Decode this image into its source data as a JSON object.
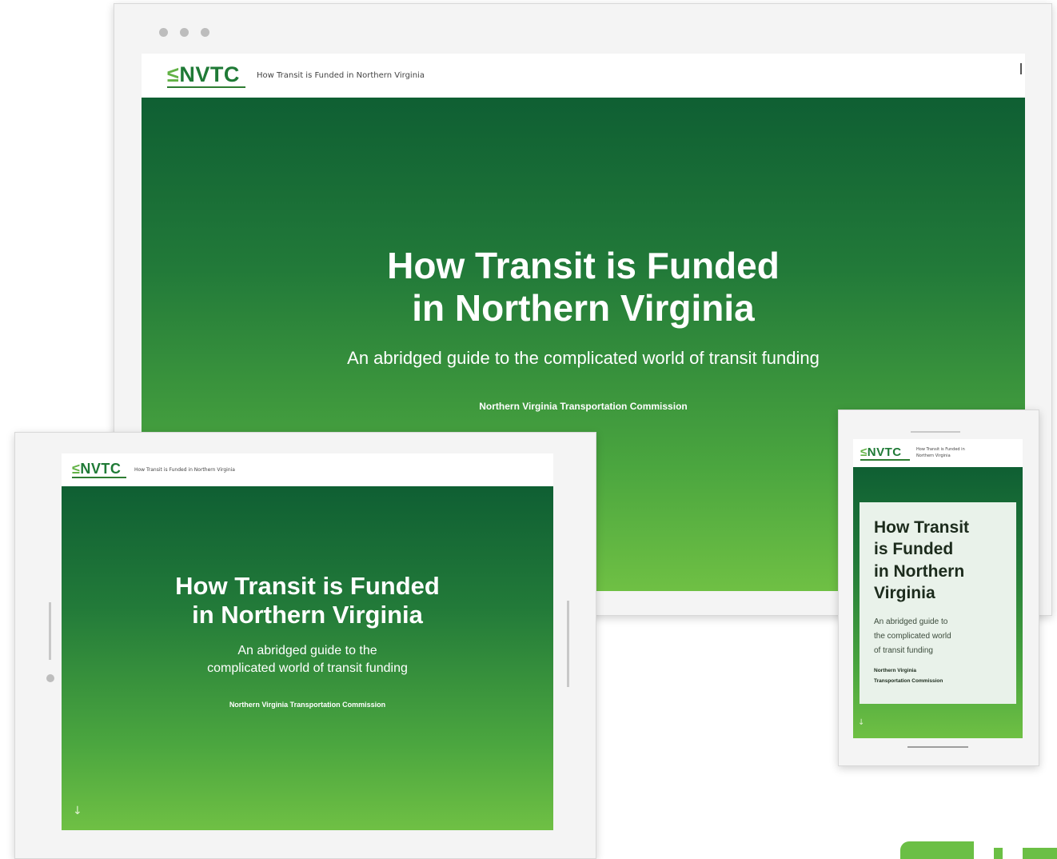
{
  "logo": {
    "text": "NVTC"
  },
  "page": {
    "topbar_title": "How Transit is Funded in Northern Virginia",
    "phone_topbar_title": "How Transit is Funded in Northern Virginia"
  },
  "hero": {
    "title_line1": "How Transit is Funded",
    "title_line2": "in Northern Virginia",
    "subtitle": "An abridged guide to the complicated world of transit funding",
    "tablet_sub_line1": "An abridged guide to the",
    "tablet_sub_line2": "complicated world of transit funding",
    "org": "Northern Virginia Transportation Commission"
  },
  "phone": {
    "title_lines": [
      "How Transit",
      "is Funded",
      "in Northern",
      "Virginia"
    ],
    "sub_lines": [
      "An abridged guide to",
      "the complicated world",
      "of transit funding"
    ],
    "org_lines": [
      "Northern Virginia",
      "Transportation Commission"
    ]
  },
  "icons": {
    "scroll": "arrow-down-icon",
    "window_dots": "window-dot-icon"
  },
  "colors": {
    "brand_green": "#1f7a36",
    "hero_top": "#0f5f33",
    "hero_bottom": "#6fc044",
    "accent_light": "#6bbf45"
  }
}
